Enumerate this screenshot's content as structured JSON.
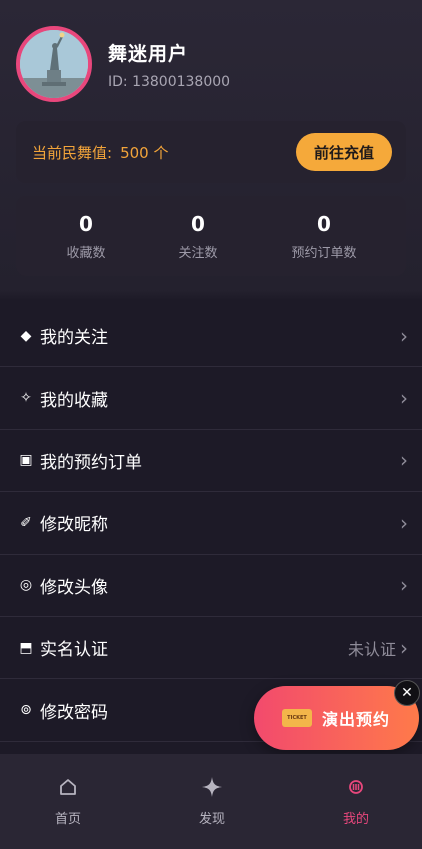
{
  "profile": {
    "name": "舞迷用户",
    "id_text": "ID: 13800138000"
  },
  "balance": {
    "label": "当前民舞值:",
    "value": "500 个",
    "button": "前往充值"
  },
  "stats": [
    {
      "num": "0",
      "label": "收藏数"
    },
    {
      "num": "0",
      "label": "关注数"
    },
    {
      "num": "0",
      "label": "预约订单数"
    }
  ],
  "menu": [
    {
      "icon": "◆",
      "label": "我的关注",
      "icon_name": "diamond-icon"
    },
    {
      "icon": "✧",
      "label": "我的收藏",
      "icon_name": "sparkle-icon"
    },
    {
      "icon": "▣",
      "label": "我的预约订单",
      "icon_name": "order-icon"
    },
    {
      "icon": "✐",
      "label": "修改昵称",
      "icon_name": "pencil-icon"
    },
    {
      "icon": "◎",
      "label": "修改头像",
      "icon_name": "avatar-icon"
    },
    {
      "icon": "⬒",
      "label": "实名认证",
      "icon_name": "id-card-icon",
      "status": "未认证"
    },
    {
      "icon": "⊚",
      "label": "修改密码",
      "icon_name": "lock-icon"
    }
  ],
  "chevron": "›",
  "fab": {
    "label": "演出预约",
    "ticket_text": "TICKET",
    "close": "✕"
  },
  "tabs": [
    {
      "label": "首页",
      "icon_name": "home-icon"
    },
    {
      "label": "发现",
      "icon_name": "discover-icon"
    },
    {
      "label": "我的",
      "icon_name": "profile-icon"
    }
  ],
  "colors": {
    "accent": "#e8477c",
    "gold": "#f2a43a",
    "background": "#1d1a27"
  }
}
